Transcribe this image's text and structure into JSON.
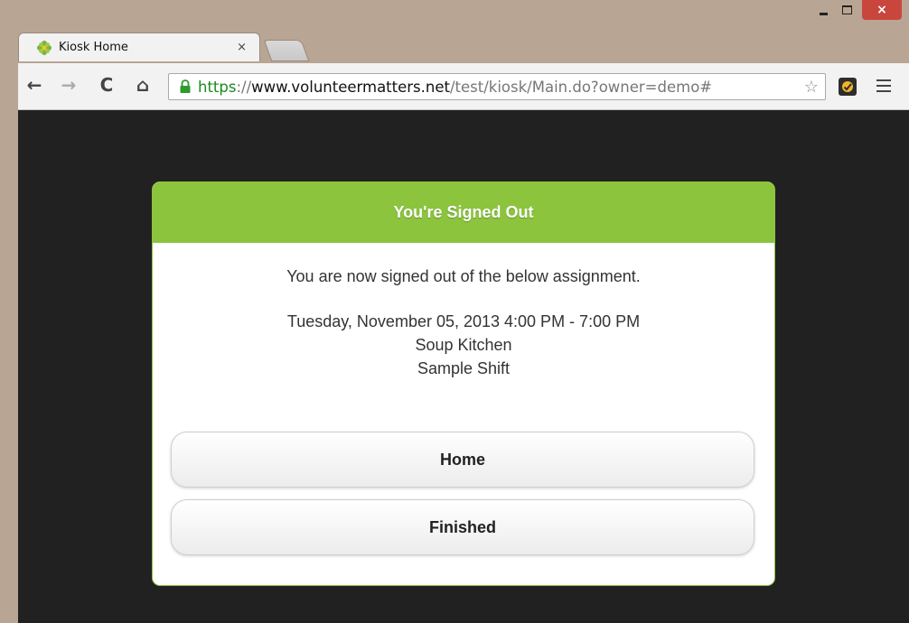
{
  "window": {
    "minimize_label": "_",
    "maximize_label": "",
    "close_label": "×"
  },
  "tab": {
    "title": "Kiosk Home",
    "close_label": "×",
    "icon": "gear-flower-icon"
  },
  "toolbar": {
    "back_label": "←",
    "forward_label": "→",
    "reload_label": "C",
    "home_label": "⌂",
    "url_scheme": "https",
    "url_separator": "://",
    "url_host": "www.volunteermatters.net",
    "url_path": "/test/kiosk/Main.do?owner=demo#",
    "star_label": "☆"
  },
  "dialog": {
    "header": "You're Signed Out",
    "message": "You are now signed out of the below assignment.",
    "assignment": {
      "datetime": "Tuesday, November 05, 2013 4:00 PM - 7:00 PM",
      "location": "Soup Kitchen",
      "shift": "Sample Shift"
    },
    "home_button": "Home",
    "finished_button": "Finished"
  },
  "colors": {
    "accent_green": "#8cc43e",
    "page_background": "#212121",
    "window_frame": "#b8a594",
    "close_red": "#c9463d",
    "https_green": "#1a8a1a"
  }
}
